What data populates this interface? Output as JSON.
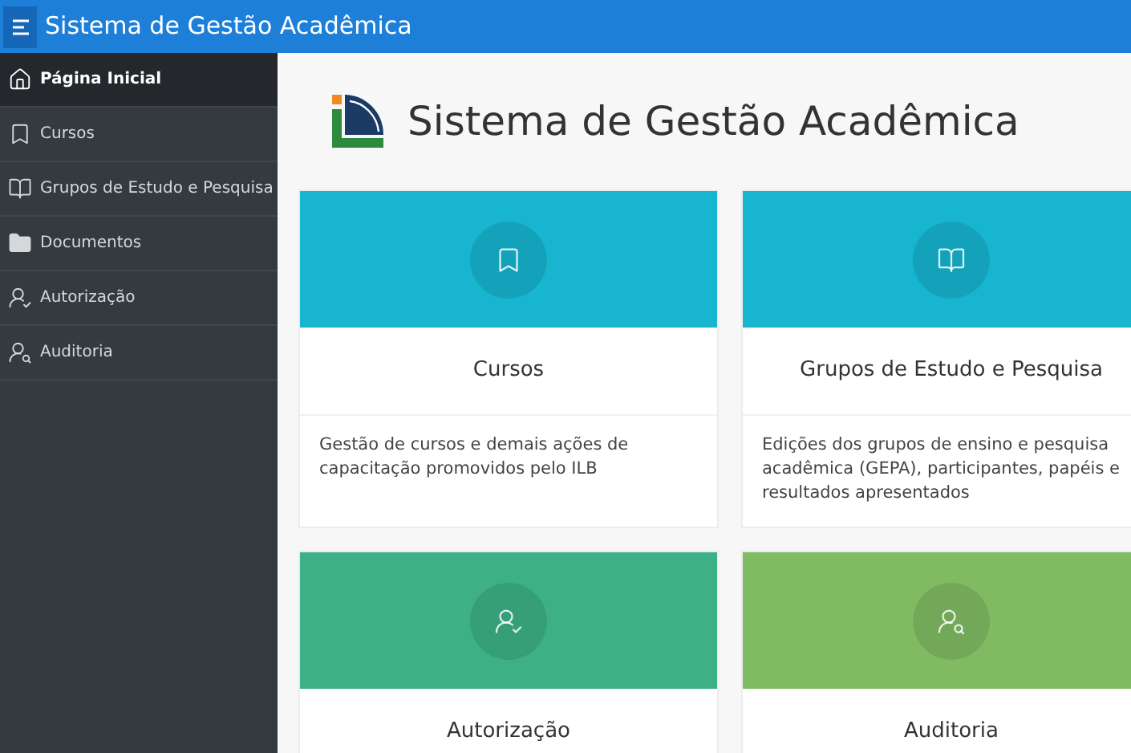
{
  "topbar": {
    "title": "Sistema de Gestão Acadêmica"
  },
  "sidebar": {
    "items": [
      {
        "label": "Página Inicial",
        "kind": "home",
        "selected": true
      },
      {
        "label": "Cursos",
        "kind": "bookmark",
        "selected": false
      },
      {
        "label": "Grupos de Estudo e Pesquisa",
        "kind": "book",
        "selected": false
      },
      {
        "label": "Documentos",
        "kind": "folder",
        "selected": false
      },
      {
        "label": "Autorização",
        "kind": "user-check",
        "selected": false
      },
      {
        "label": "Auditoria",
        "kind": "user-search",
        "selected": false
      }
    ]
  },
  "header": {
    "title": "Sistema de Gestão Acadêmica"
  },
  "cards": [
    {
      "title": "Cursos",
      "description": "Gestão de cursos e demais ações de capacitação promovidos pelo ILB",
      "kind": "bookmark",
      "color": "#17b5d0"
    },
    {
      "title": "Grupos de Estudo e Pesquisa",
      "description": "Edições dos grupos de ensino e pesquisa acadêmica (GEPA), participantes, papéis e resultados apresentados",
      "kind": "book",
      "color": "#17b5d0"
    },
    {
      "title": "Autorização",
      "kind": "user-check",
      "color": "#3db087"
    },
    {
      "title": "Auditoria",
      "kind": "user-search",
      "color": "#80bb62"
    }
  ]
}
